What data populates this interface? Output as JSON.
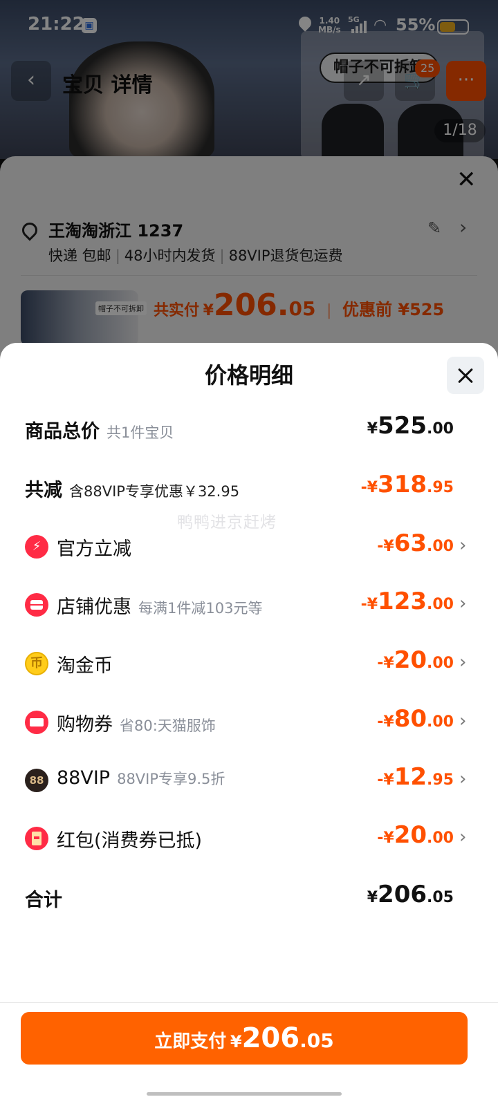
{
  "status_bar": {
    "time": "21:22",
    "net_speed_value": "1.40",
    "net_speed_unit": "MB/s",
    "network": "5G",
    "battery": "55%"
  },
  "background": {
    "nav_title": "宝贝 详情",
    "banner_text": "帽子不可拆卸",
    "cart_count": "25",
    "image_counter": "1/18",
    "address": "王淘淘浙江 1237",
    "shipping": [
      "快递 包邮",
      "48小时内发货",
      "88VIP退货包运费"
    ],
    "thumb_tag": "帽子不可拆卸",
    "paid_label": "共实付",
    "paid_currency": "¥",
    "paid_int": "206.",
    "paid_dec": "05",
    "before_label": "优惠前 ¥525"
  },
  "sheet": {
    "title": "价格明细",
    "watermark": "鸭鸭进京赶烤",
    "rows": [
      {
        "name": "商品总价",
        "desc": "共1件宝贝",
        "cur": "¥",
        "int": "525",
        "dec": ".00"
      },
      {
        "name": "共减",
        "desc": "含88VIP专享优惠￥32.95",
        "cur": "-¥",
        "int": "318",
        "dec": ".95"
      },
      {
        "name": "官方立减",
        "desc": "",
        "cur": "-¥",
        "int": "63",
        "dec": ".00",
        "icon": "bolt-icon"
      },
      {
        "name": "店铺优惠",
        "desc": "每满1件减103元等",
        "cur": "-¥",
        "int": "123",
        "dec": ".00",
        "icon": "shop-icon"
      },
      {
        "name": "淘金币",
        "desc": "",
        "cur": "-¥",
        "int": "20",
        "dec": ".00",
        "icon": "coin-icon"
      },
      {
        "name": "购物券",
        "desc": "省80:天猫服饰",
        "cur": "-¥",
        "int": "80",
        "dec": ".00",
        "icon": "coupon-icon"
      },
      {
        "name": "88VIP",
        "desc": "88VIP专享9.5折",
        "cur": "-¥",
        "int": "12",
        "dec": ".95",
        "icon": "vip88-icon"
      },
      {
        "name": "红包(消费券已抵)",
        "desc": "",
        "cur": "-¥",
        "int": "20",
        "dec": ".00",
        "icon": "red-packet-icon"
      },
      {
        "name": "合计",
        "desc": "",
        "cur": "¥",
        "int": "206",
        "dec": ".05"
      }
    ],
    "icon_glyphs": {
      "bolt": "⚡",
      "coin": "币",
      "vip": "88"
    },
    "chevron": "›"
  },
  "pay_button": {
    "label": "立即支付",
    "cur": "¥",
    "int": "206",
    "dec": ".05"
  },
  "colors": {
    "accent": "#ff5000",
    "pay_button": "#ff6200",
    "icon_red": "#ff2b45"
  }
}
